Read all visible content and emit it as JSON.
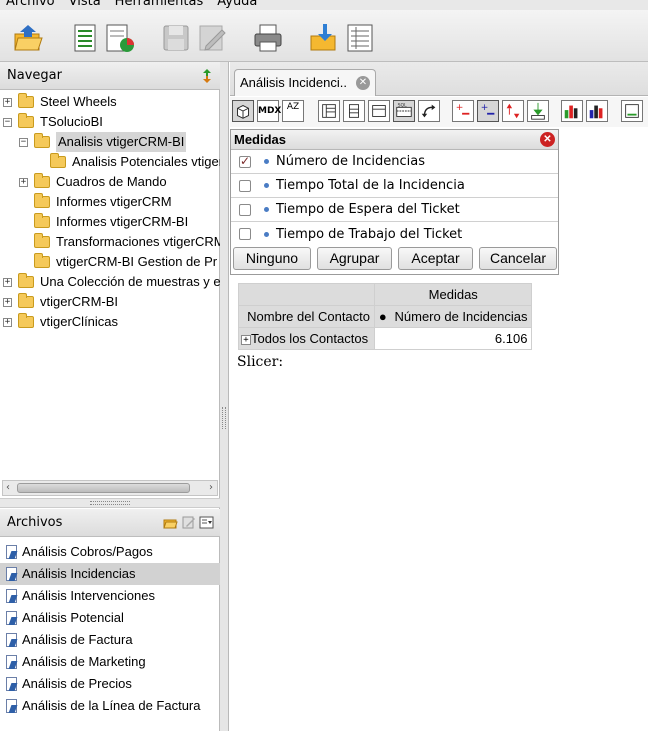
{
  "menu": {
    "items": [
      "Archivo",
      "Vista",
      "Herramientas",
      "Ayuda"
    ]
  },
  "toolbar": {
    "buttons": [
      "open-folder-icon",
      "new-report-icon",
      "new-analysis-icon",
      "save-icon",
      "edit-icon",
      "print-icon",
      "publish-icon",
      "workspace-icon"
    ]
  },
  "navegar": {
    "title": "Navegar",
    "tree": [
      "Steel Wheels",
      "TSolucioBI",
      "Analisis vtigerCRM-BI",
      "Analisis Potenciales vtiger",
      "Cuadros de Mando",
      "Informes vtigerCRM",
      "Informes vtigerCRM-BI",
      "Transformaciones vtigerCRM",
      "vtigerCRM-BI Gestion de Pr",
      "Una Colección de muestras y e",
      "vtigerCRM-BI",
      "vtigerClínicas"
    ]
  },
  "archivos": {
    "title": "Archivos",
    "items": [
      "Análisis Cobros/Pagos",
      "Análisis Incidencias",
      "Análisis Intervenciones",
      "Análisis Potencial",
      "Análisis de Factura",
      "Análisis de Marketing",
      "Análisis de Precios",
      "Análisis de la Línea de Factura"
    ],
    "selected": "Análisis Incidencias"
  },
  "tab": {
    "label": "Análisis Incidenci.."
  },
  "pivot_toolbar": {
    "mdx_label": "MDX",
    "sort_label": "AZ"
  },
  "medidas": {
    "title": "Medidas",
    "options": [
      {
        "label": "Número de Incidencias",
        "checked": true
      },
      {
        "label": "Tiempo Total de la Incidencia",
        "checked": false
      },
      {
        "label": "Tiempo de Espera del Ticket",
        "checked": false
      },
      {
        "label": "Tiempo de Trabajo del Ticket",
        "checked": false
      }
    ],
    "buttons": {
      "none": "Ninguno",
      "group": "Agrupar",
      "accept": "Aceptar",
      "cancel": "Cancelar"
    }
  },
  "pivot": {
    "col_group": "Medidas",
    "row_header": "Nombre del Contacto",
    "measure_header": "Número de Incidencias",
    "row_label": "Todos los Contactos",
    "value": "6.106"
  },
  "slicer": {
    "label": "Slicer:"
  }
}
